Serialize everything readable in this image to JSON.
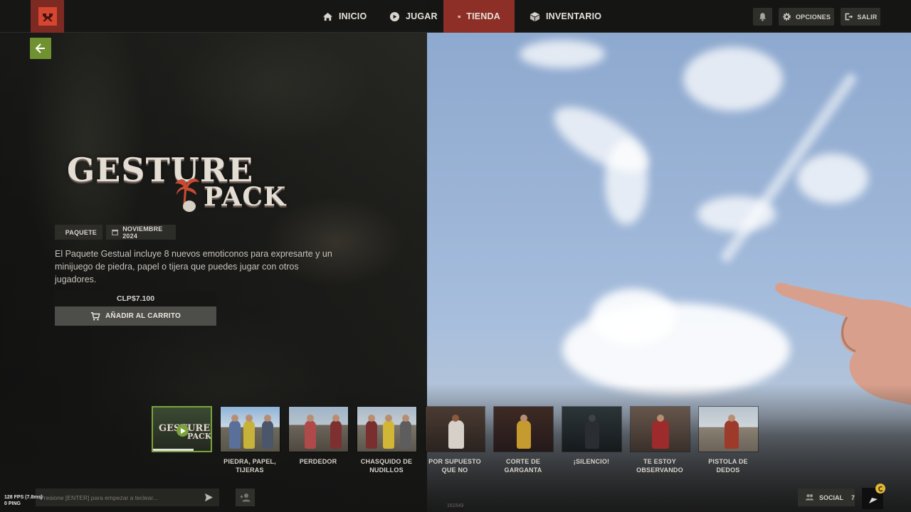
{
  "nav": {
    "items": [
      {
        "label": "INICIO",
        "icon": "home-icon"
      },
      {
        "label": "JUGAR",
        "icon": "play-circle-icon"
      },
      {
        "label": "TIENDA",
        "icon": "store-icon",
        "active": true
      },
      {
        "label": "INVENTARIO",
        "icon": "box-icon"
      }
    ],
    "opciones_label": "OPCIONES",
    "salir_label": "SALIR"
  },
  "product": {
    "title_line1": "GESTURE",
    "title_line2": "PACK",
    "tag_type": "PAQUETE",
    "tag_date": "NOVIEMBRE 2024",
    "description": "El Paquete Gestual incluye 8 nuevos emoticonos para expresarte y un minijuego de piedra, papel o tijera que puedes jugar con otros jugadores.",
    "price": "CLP$7.100",
    "add_to_cart_label": "AÑADIR AL CARRITO"
  },
  "thumbnails": [
    {
      "label": "",
      "mini_title1": "GESTURE",
      "mini_title2": "PACK",
      "selected": true,
      "progress": 0.7
    },
    {
      "label": "PIEDRA, PAPEL, TIJERAS"
    },
    {
      "label": "PERDEDOR"
    },
    {
      "label": "CHASQUIDO DE NUDILLOS"
    },
    {
      "label": "POR SUPUESTO QUE NO"
    },
    {
      "label": "CORTE DE GARGANTA"
    },
    {
      "label": "¡SILENCIO!"
    },
    {
      "label": "TE ESTOY OBSERVANDO"
    },
    {
      "label": "PISTOLA DE DEDOS"
    }
  ],
  "bottom": {
    "fps_line1": "128 FPS (7.8ms)",
    "fps_line2": "0 PING",
    "chat_placeholder": "Presione [ENTER] para empezar a teclear...",
    "build_id": "161543",
    "social_label": "SOCIAL",
    "social_count": "7"
  },
  "colors": {
    "accent_red": "#8d2f26",
    "back_green": "#6f9130",
    "selected_green": "#7ca33b"
  }
}
